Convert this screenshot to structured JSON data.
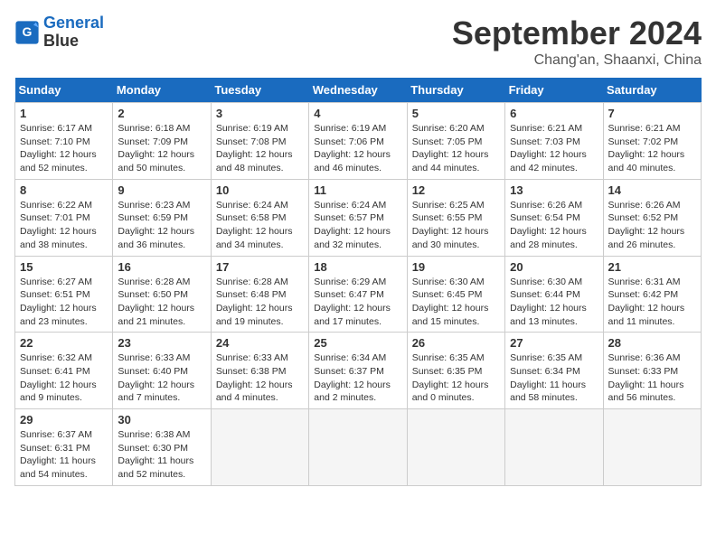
{
  "header": {
    "logo_line1": "General",
    "logo_line2": "Blue",
    "month": "September 2024",
    "location": "Chang'an, Shaanxi, China"
  },
  "weekdays": [
    "Sunday",
    "Monday",
    "Tuesday",
    "Wednesday",
    "Thursday",
    "Friday",
    "Saturday"
  ],
  "days": [
    {
      "date": 1,
      "rise": "6:17 AM",
      "set": "7:10 PM",
      "daylight": "12 hours and 52 minutes."
    },
    {
      "date": 2,
      "rise": "6:18 AM",
      "set": "7:09 PM",
      "daylight": "12 hours and 50 minutes."
    },
    {
      "date": 3,
      "rise": "6:19 AM",
      "set": "7:08 PM",
      "daylight": "12 hours and 48 minutes."
    },
    {
      "date": 4,
      "rise": "6:19 AM",
      "set": "7:06 PM",
      "daylight": "12 hours and 46 minutes."
    },
    {
      "date": 5,
      "rise": "6:20 AM",
      "set": "7:05 PM",
      "daylight": "12 hours and 44 minutes."
    },
    {
      "date": 6,
      "rise": "6:21 AM",
      "set": "7:03 PM",
      "daylight": "12 hours and 42 minutes."
    },
    {
      "date": 7,
      "rise": "6:21 AM",
      "set": "7:02 PM",
      "daylight": "12 hours and 40 minutes."
    },
    {
      "date": 8,
      "rise": "6:22 AM",
      "set": "7:01 PM",
      "daylight": "12 hours and 38 minutes."
    },
    {
      "date": 9,
      "rise": "6:23 AM",
      "set": "6:59 PM",
      "daylight": "12 hours and 36 minutes."
    },
    {
      "date": 10,
      "rise": "6:24 AM",
      "set": "6:58 PM",
      "daylight": "12 hours and 34 minutes."
    },
    {
      "date": 11,
      "rise": "6:24 AM",
      "set": "6:57 PM",
      "daylight": "12 hours and 32 minutes."
    },
    {
      "date": 12,
      "rise": "6:25 AM",
      "set": "6:55 PM",
      "daylight": "12 hours and 30 minutes."
    },
    {
      "date": 13,
      "rise": "6:26 AM",
      "set": "6:54 PM",
      "daylight": "12 hours and 28 minutes."
    },
    {
      "date": 14,
      "rise": "6:26 AM",
      "set": "6:52 PM",
      "daylight": "12 hours and 26 minutes."
    },
    {
      "date": 15,
      "rise": "6:27 AM",
      "set": "6:51 PM",
      "daylight": "12 hours and 23 minutes."
    },
    {
      "date": 16,
      "rise": "6:28 AM",
      "set": "6:50 PM",
      "daylight": "12 hours and 21 minutes."
    },
    {
      "date": 17,
      "rise": "6:28 AM",
      "set": "6:48 PM",
      "daylight": "12 hours and 19 minutes."
    },
    {
      "date": 18,
      "rise": "6:29 AM",
      "set": "6:47 PM",
      "daylight": "12 hours and 17 minutes."
    },
    {
      "date": 19,
      "rise": "6:30 AM",
      "set": "6:45 PM",
      "daylight": "12 hours and 15 minutes."
    },
    {
      "date": 20,
      "rise": "6:30 AM",
      "set": "6:44 PM",
      "daylight": "12 hours and 13 minutes."
    },
    {
      "date": 21,
      "rise": "6:31 AM",
      "set": "6:42 PM",
      "daylight": "12 hours and 11 minutes."
    },
    {
      "date": 22,
      "rise": "6:32 AM",
      "set": "6:41 PM",
      "daylight": "12 hours and 9 minutes."
    },
    {
      "date": 23,
      "rise": "6:33 AM",
      "set": "6:40 PM",
      "daylight": "12 hours and 7 minutes."
    },
    {
      "date": 24,
      "rise": "6:33 AM",
      "set": "6:38 PM",
      "daylight": "12 hours and 4 minutes."
    },
    {
      "date": 25,
      "rise": "6:34 AM",
      "set": "6:37 PM",
      "daylight": "12 hours and 2 minutes."
    },
    {
      "date": 26,
      "rise": "6:35 AM",
      "set": "6:35 PM",
      "daylight": "12 hours and 0 minutes."
    },
    {
      "date": 27,
      "rise": "6:35 AM",
      "set": "6:34 PM",
      "daylight": "11 hours and 58 minutes."
    },
    {
      "date": 28,
      "rise": "6:36 AM",
      "set": "6:33 PM",
      "daylight": "11 hours and 56 minutes."
    },
    {
      "date": 29,
      "rise": "6:37 AM",
      "set": "6:31 PM",
      "daylight": "11 hours and 54 minutes."
    },
    {
      "date": 30,
      "rise": "6:38 AM",
      "set": "6:30 PM",
      "daylight": "11 hours and 52 minutes."
    }
  ]
}
